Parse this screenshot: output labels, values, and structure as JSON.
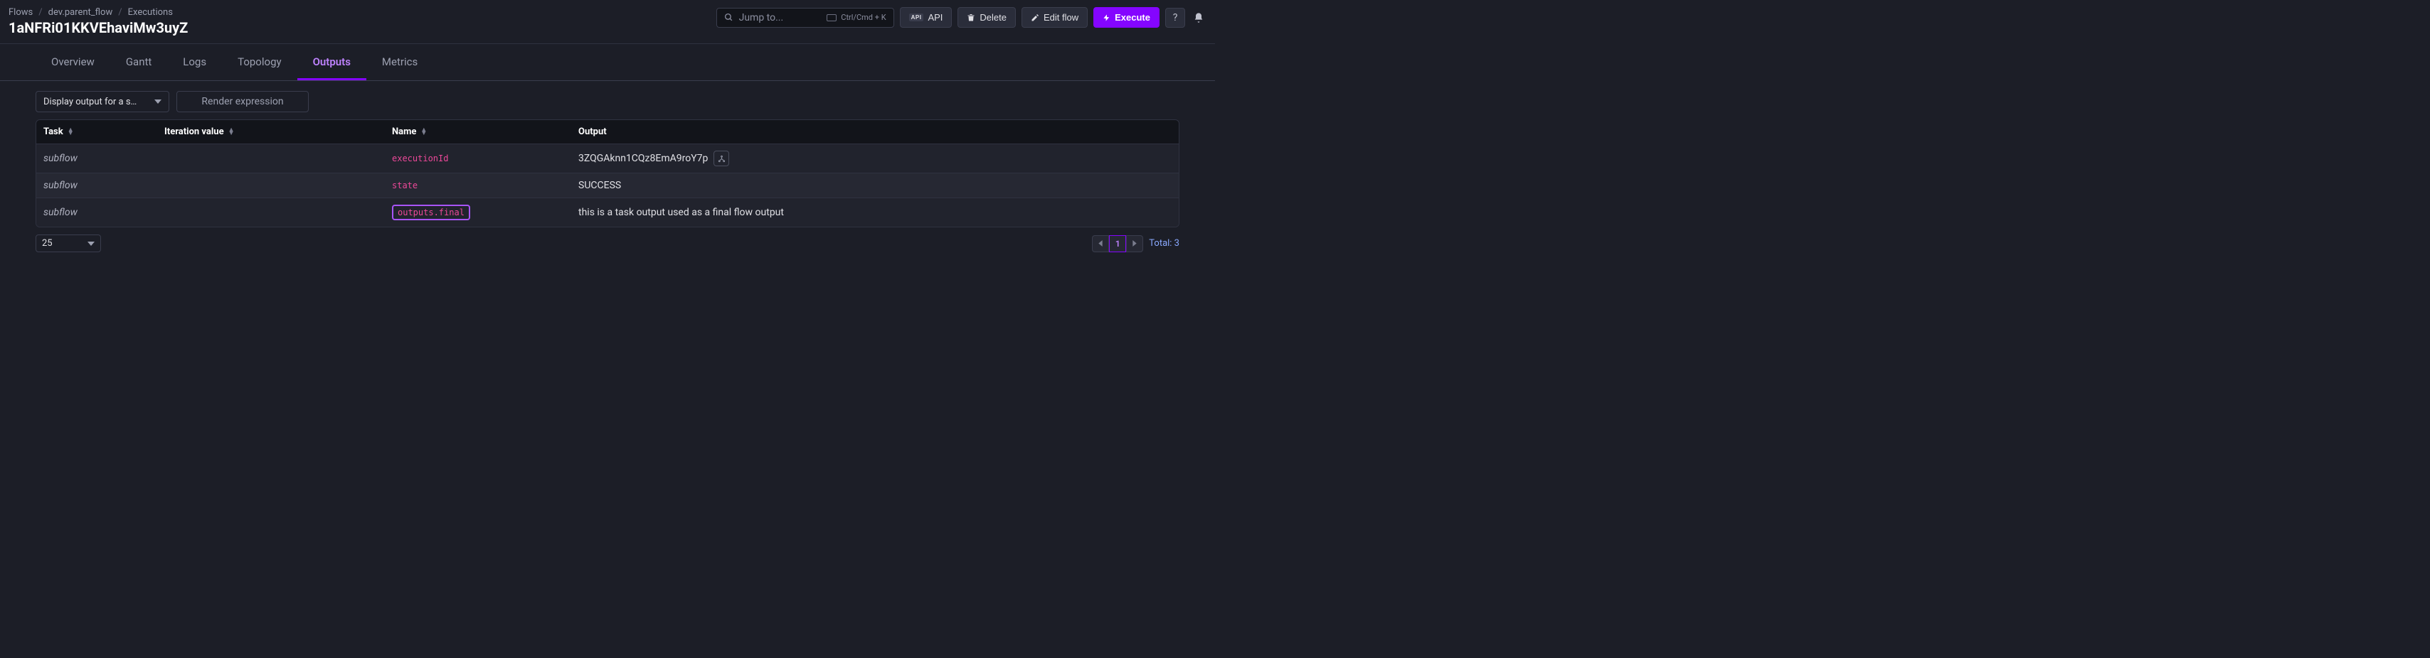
{
  "breadcrumb": {
    "flows": "Flows",
    "flow_id": "dev.parent_flow",
    "executions": "Executions"
  },
  "page_title": "1aNFRi01KKVEhaviMw3uyZ",
  "search": {
    "placeholder": "Jump to...",
    "shortcut": "Ctrl/Cmd + K"
  },
  "actions": {
    "api": "API",
    "delete": "Delete",
    "edit": "Edit flow",
    "execute": "Execute",
    "help": "?"
  },
  "tabs": [
    "Overview",
    "Gantt",
    "Logs",
    "Topology",
    "Outputs",
    "Metrics"
  ],
  "active_tab": "Outputs",
  "filters": {
    "select_label": "Display output for a s…",
    "render_placeholder": "Render expression"
  },
  "table": {
    "headers": {
      "task": "Task",
      "iteration": "Iteration value",
      "name": "Name",
      "output": "Output"
    },
    "rows": [
      {
        "task": "subflow",
        "iteration": "",
        "name": "executionId",
        "output": "3ZQGAknn1CQz8EmA9roY7p",
        "has_tree": true,
        "highlighted": false
      },
      {
        "task": "subflow",
        "iteration": "",
        "name": "state",
        "output": "SUCCESS",
        "has_tree": false,
        "highlighted": false
      },
      {
        "task": "subflow",
        "iteration": "",
        "name": "outputs.final",
        "output": "this is a task output used as a final flow output",
        "has_tree": false,
        "highlighted": true
      }
    ]
  },
  "footer": {
    "page_size": "25",
    "current_page": "1",
    "total": "Total: 3"
  }
}
